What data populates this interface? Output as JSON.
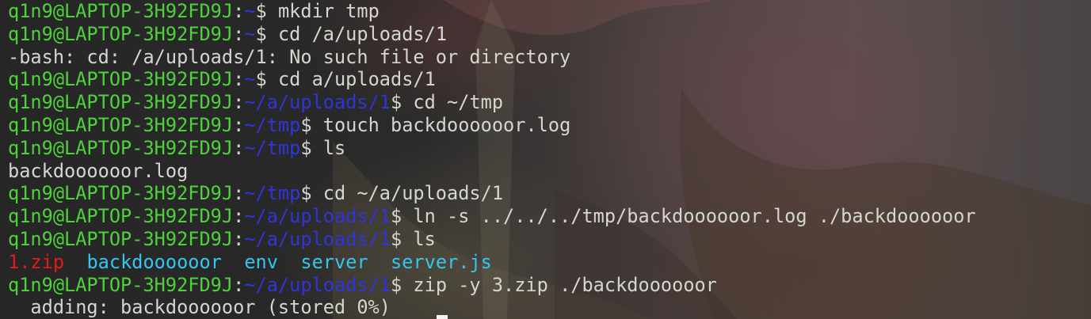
{
  "prompt": {
    "user_host": "q1n9@LAPTOP-3H92FD9J",
    "colon": ":",
    "dollar": "$ "
  },
  "lines": [
    {
      "type": "cmd",
      "path": "~",
      "command": "mkdir tmp"
    },
    {
      "type": "cmd",
      "path": "~",
      "command": "cd /a/uploads/1"
    },
    {
      "type": "out",
      "text": "-bash: cd: /a/uploads/1: No such file or directory"
    },
    {
      "type": "cmd",
      "path": "~",
      "command": "cd a/uploads/1"
    },
    {
      "type": "cmd",
      "path": "~/a/uploads/1",
      "command": "cd ~/tmp"
    },
    {
      "type": "cmd",
      "path": "~/tmp",
      "command": "touch backdoooooor.log"
    },
    {
      "type": "cmd",
      "path": "~/tmp",
      "command": "ls"
    },
    {
      "type": "out",
      "text": "backdoooooor.log"
    },
    {
      "type": "cmd",
      "path": "~/tmp",
      "command": "cd ~/a/uploads/1"
    },
    {
      "type": "cmd",
      "path": "~/a/uploads/1",
      "command": "ln -s ../../../tmp/backdoooooor.log ./backdoooooor"
    },
    {
      "type": "cmd",
      "path": "~/a/uploads/1",
      "command": "ls"
    },
    {
      "type": "ls",
      "items": [
        {
          "name": "1.zip",
          "kind": "zipf"
        },
        {
          "name": "backdoooooor",
          "kind": "lnk"
        },
        {
          "name": "env",
          "kind": "dir"
        },
        {
          "name": "server",
          "kind": "dir"
        },
        {
          "name": "server.js",
          "kind": "exe"
        }
      ]
    },
    {
      "type": "cmd",
      "path": "~/a/uploads/1",
      "command": "zip -y 3.zip ./backdoooooor"
    },
    {
      "type": "out",
      "text": "  adding: backdoooooor (stored 0%)"
    }
  ],
  "colors": {
    "user_host": "#4ed23a",
    "path": "#2f35d6",
    "text": "#d3d7cf",
    "zip_file": "#e01b1b",
    "link_dir_exec": "#34c6ee"
  }
}
